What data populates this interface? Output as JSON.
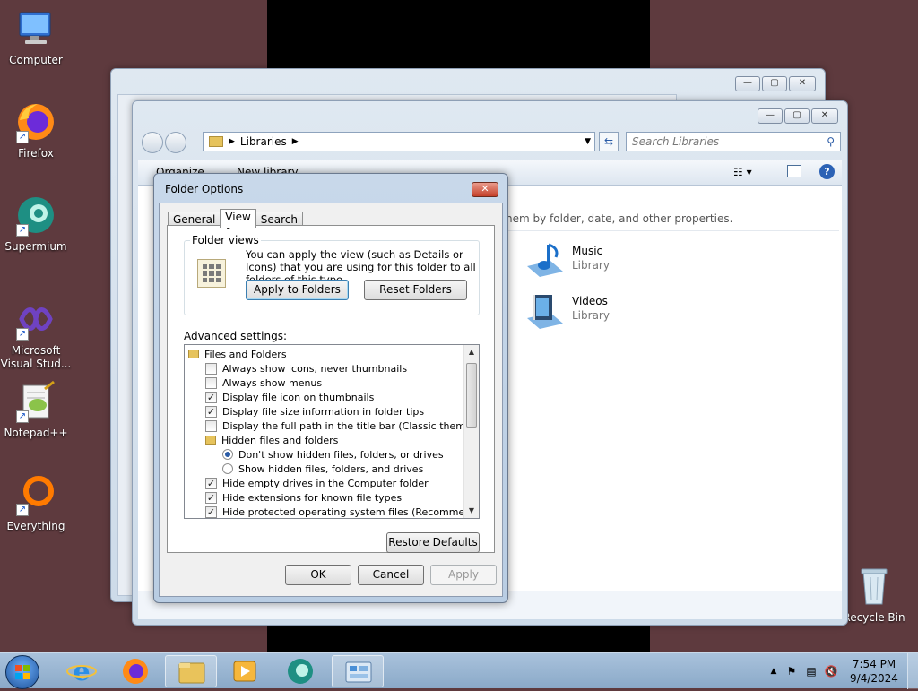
{
  "desktop": {
    "icons": [
      {
        "label": "Computer",
        "icon": "computer-icon"
      },
      {
        "label": "Firefox",
        "icon": "firefox-icon"
      },
      {
        "label": "Supermium",
        "icon": "supermium-icon"
      },
      {
        "label": "Microsoft Visual Stud...",
        "icon": "visual-studio-icon"
      },
      {
        "label": "Notepad++",
        "icon": "notepadpp-icon"
      },
      {
        "label": "Everything",
        "icon": "everything-icon"
      },
      {
        "label": "Recycle Bin",
        "icon": "recycle-bin-icon"
      }
    ]
  },
  "explorer": {
    "address": [
      "Libraries"
    ],
    "search_placeholder": "Search Libraries",
    "toolbar": {
      "organize": "Organize",
      "new_library": "New library"
    },
    "description_fragment": "hem by folder, date, and other properties.",
    "libraries": [
      {
        "name": "Music",
        "type": "Library",
        "icon": "music-library-icon"
      },
      {
        "name": "Videos",
        "type": "Library",
        "icon": "videos-library-icon"
      }
    ]
  },
  "dialog": {
    "title": "Folder Options",
    "tabs": [
      "General",
      "View",
      "Search"
    ],
    "active_tab": "View",
    "folder_views": {
      "label": "Folder views",
      "text": "You can apply the view (such as Details or Icons) that you are using for this folder to all folders of this type.",
      "apply_button": "Apply to Folders",
      "reset_button": "Reset Folders"
    },
    "advanced_label": "Advanced settings:",
    "settings": [
      {
        "kind": "folder",
        "indent": 0,
        "label": "Files and Folders"
      },
      {
        "kind": "check",
        "indent": 1,
        "checked": false,
        "label": "Always show icons, never thumbnails"
      },
      {
        "kind": "check",
        "indent": 1,
        "checked": false,
        "label": "Always show menus"
      },
      {
        "kind": "check",
        "indent": 1,
        "checked": true,
        "label": "Display file icon on thumbnails"
      },
      {
        "kind": "check",
        "indent": 1,
        "checked": true,
        "label": "Display file size information in folder tips"
      },
      {
        "kind": "check",
        "indent": 1,
        "checked": false,
        "label": "Display the full path in the title bar (Classic theme only)"
      },
      {
        "kind": "folder",
        "indent": 1,
        "label": "Hidden files and folders"
      },
      {
        "kind": "radio",
        "indent": 2,
        "checked": true,
        "label": "Don't show hidden files, folders, or drives"
      },
      {
        "kind": "radio",
        "indent": 2,
        "checked": false,
        "label": "Show hidden files, folders, and drives"
      },
      {
        "kind": "check",
        "indent": 1,
        "checked": true,
        "label": "Hide empty drives in the Computer folder"
      },
      {
        "kind": "check",
        "indent": 1,
        "checked": true,
        "label": "Hide extensions for known file types"
      },
      {
        "kind": "check",
        "indent": 1,
        "checked": true,
        "label": "Hide protected operating system files (Recommended)"
      }
    ],
    "restore_button": "Restore Defaults",
    "ok_button": "OK",
    "cancel_button": "Cancel",
    "apply_button": "Apply"
  },
  "taskbar": {
    "items": [
      "internet-explorer-icon",
      "firefox-icon",
      "windows-explorer-icon",
      "media-player-icon",
      "supermium-icon",
      "control-panel-icon"
    ],
    "time": "7:54 PM",
    "date": "9/4/2024"
  }
}
